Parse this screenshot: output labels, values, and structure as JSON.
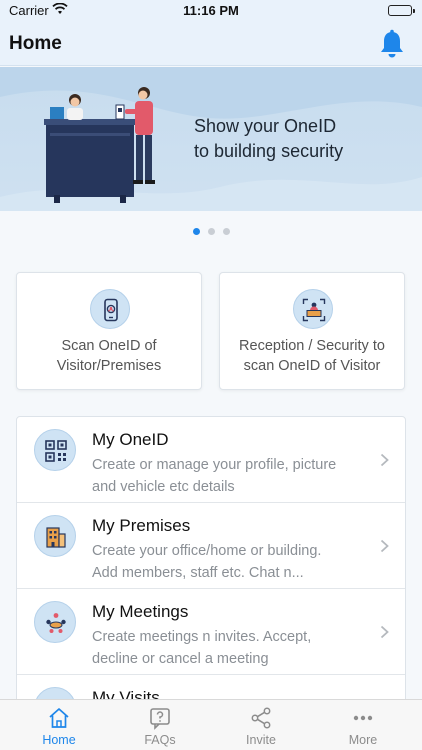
{
  "status_bar": {
    "carrier": "Carrier",
    "time": "11:16 PM"
  },
  "header": {
    "title": "Home"
  },
  "banner": {
    "line1": "Show your OneID",
    "line2": "to building security",
    "page_count": 3,
    "active_page": 1
  },
  "actions": [
    {
      "line1": "Scan OneID of",
      "line2": "Visitor/Premises",
      "icon": "phone-scan-icon"
    },
    {
      "line1": "Reception / Security to",
      "line2": "scan OneID of Visitor",
      "icon": "reception-desk-icon"
    }
  ],
  "menu": [
    {
      "title": "My OneID",
      "line1": "Create or manage your profile, picture",
      "line2": "and vehicle etc details",
      "icon": "qr-code-icon"
    },
    {
      "title": "My Premises",
      "line1": "Create your office/home or building.",
      "line2": "Add members, staff etc. Chat n...",
      "icon": "building-icon"
    },
    {
      "title": "My Meetings",
      "line1": "Create meetings n invites. Accept,",
      "line2": "decline or cancel a meeting",
      "icon": "meeting-icon"
    },
    {
      "title": "My Visits",
      "line1": "",
      "line2": "",
      "icon": "visits-icon"
    }
  ],
  "tabs": [
    {
      "label": "Home",
      "icon": "home-icon",
      "active": true
    },
    {
      "label": "FAQs",
      "icon": "faq-icon",
      "active": false
    },
    {
      "label": "Invite",
      "icon": "share-icon",
      "active": false
    },
    {
      "label": "More",
      "icon": "more-dots-icon",
      "active": false
    }
  ],
  "colors": {
    "accent": "#1e86ea",
    "nav_background": "#e9f2fb",
    "banner_background": "#c7dcee",
    "icon_circle": "#cfe3f4"
  }
}
